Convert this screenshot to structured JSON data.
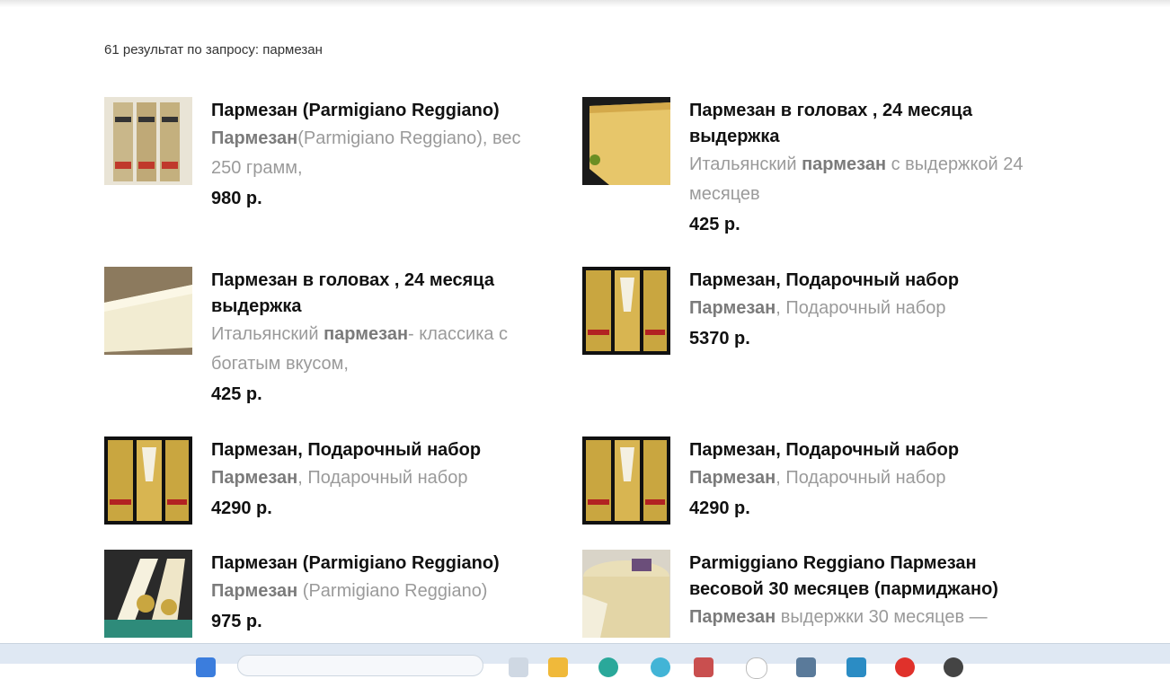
{
  "search": {
    "results_label": "61 результат по запросу: пармезан"
  },
  "products": [
    {
      "title": "Пармезан (Parmigiano Reggiano)",
      "desc_bold": "Пармезан",
      "desc_rest": "(Parmigiano Reggiano), вес 250 грамм,",
      "desc_pre": "",
      "price": "980 р.",
      "image": "three-wrapped-parmesan-bars"
    },
    {
      "title": "Пармезан в головах , 24 месяца выдержка",
      "desc_pre": "Итальянский ",
      "desc_bold": "пармезан",
      "desc_rest": " с выдержкой 24 месяцев",
      "price": "425 р.",
      "image": "parmesan-wedge-block"
    },
    {
      "title": "Пармезан в головах , 24 месяца выдержка",
      "desc_pre": "Итальянский ",
      "desc_bold": "пармезан",
      "desc_rest": "- классика с богатым вкусом,",
      "price": "425 р.",
      "image": "parmesan-triangle-on-burlap"
    },
    {
      "title": "Пармезан, Подарочный набор",
      "desc_pre": "",
      "desc_bold": "Пармезан",
      "desc_rest": ", Подарочный набор",
      "price": "5370 р.",
      "image": "parmesan-gift-box"
    },
    {
      "title": "Пармезан, Подарочный набор",
      "desc_pre": "",
      "desc_bold": "Пармезан",
      "desc_rest": ", Подарочный набор",
      "price": "4290 р.",
      "image": "parmesan-gift-box"
    },
    {
      "title": "Пармезан, Подарочный набор",
      "desc_pre": "",
      "desc_bold": "Пармезан",
      "desc_rest": ", Подарочный набор",
      "price": "4290 р.",
      "image": "parmesan-gift-box"
    },
    {
      "title": "Пармезан (Parmigiano Reggiano)",
      "desc_pre": "",
      "desc_bold": "Пармезан",
      "desc_rest": " (Parmigiano Reggiano)",
      "price": "975 р.",
      "image": "parmesan-wedges-green"
    },
    {
      "title": "Parmiggiano Reggiano Пармезан весовой 30 месяцев (пармиджано)",
      "desc_pre": "",
      "desc_bold": "Пармезан",
      "desc_rest": " выдержки 30 месяцев —",
      "price": "",
      "image": "parmesan-wheel"
    }
  ],
  "colors": {
    "title": "#111111",
    "description": "#9a9a9a",
    "taskbar": "#dfe8f3"
  }
}
